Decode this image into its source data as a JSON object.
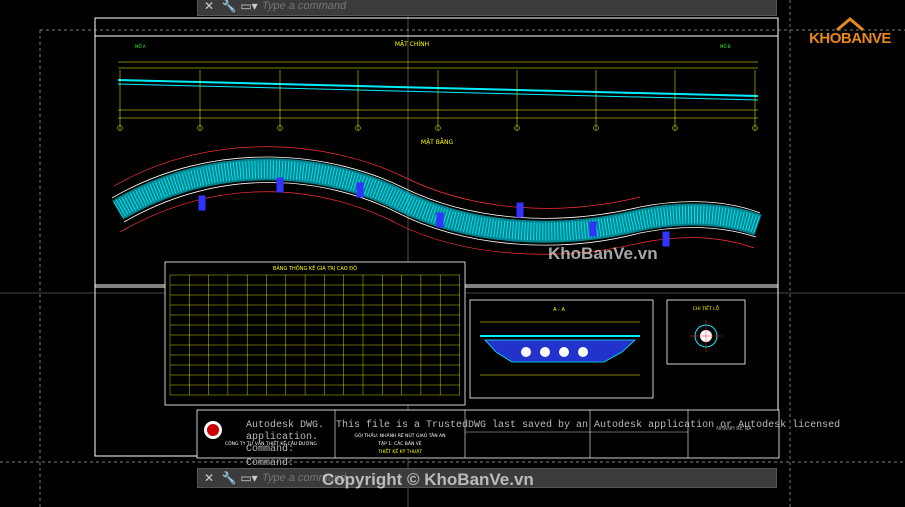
{
  "cmd_top": {
    "placeholder": "Type a command"
  },
  "cmd_bottom": {
    "placeholder": "Type a command"
  },
  "history": {
    "line1": "Autodesk DWG.  This file is a TrustedDWG last saved by an Autodesk application or Autodesk licensed",
    "line2": "application.",
    "line3": "Command:",
    "line4": "Command:"
  },
  "logo": {
    "text": "KHOBANVE"
  },
  "watermarks": {
    "center": "KhoBanVe.vn",
    "footer": "Copyright © KhoBanVe.vn"
  },
  "drawing": {
    "elevation_title": "MẶT CHÍNH",
    "plan_title": "MẶT BẰNG",
    "table_title": "BẢNG THỐNG KÊ GIÁ TRỊ CAO ĐỘ",
    "section_title": "A - A",
    "detail_title": "CHI TIẾT LỖ",
    "titleblock": {
      "company": "CÔNG TY TƯ VẤN THIẾT KẾ CẦU ĐƯỜNG",
      "project": "GÓI THẦU: NHÁNH RẼ NÚT GIAO TÂN AN",
      "sheet": "TẬP 1: CÁC BẢN VẼ",
      "phase": "THIẾT KẾ KỸ THUẬT",
      "drawing_name": "NHÁNH RẼ NA"
    }
  },
  "colors": {
    "accent": "#e8891c",
    "cad_yellow": "#ffff00",
    "cad_cyan": "#00e5ff",
    "cad_white": "#ffffff"
  }
}
